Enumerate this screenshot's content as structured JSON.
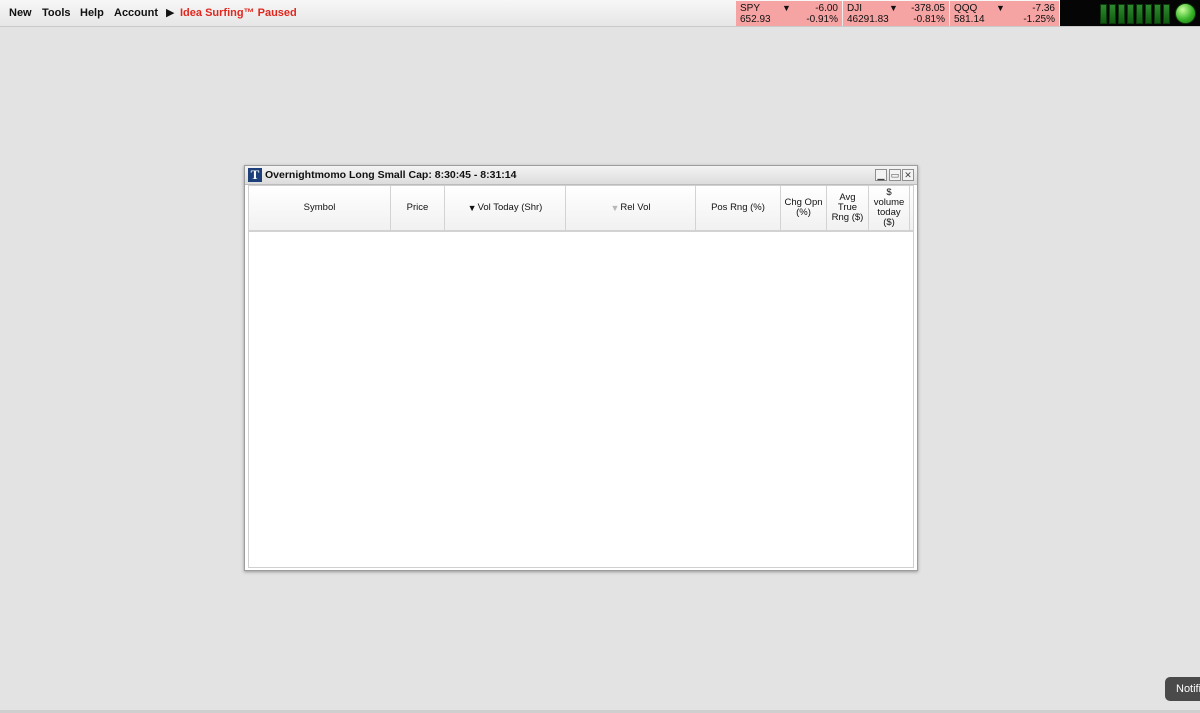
{
  "menubar": {
    "items": [
      {
        "label": "New"
      },
      {
        "label": "Tools"
      },
      {
        "label": "Help"
      },
      {
        "label": "Account"
      }
    ],
    "idea_status": "Idea Surfing™ Paused",
    "play_glyph": "▶"
  },
  "tickers": [
    {
      "symbol": "SPY",
      "change": "-6.00",
      "price": "652.93",
      "percent": "-0.91%",
      "direction": "down"
    },
    {
      "symbol": "DJI",
      "change": "-378.05",
      "price": "46291.83",
      "percent": "-0.81%",
      "direction": "down"
    },
    {
      "symbol": "QQQ",
      "change": "-7.36",
      "price": "581.14",
      "percent": "-1.25%",
      "direction": "down"
    }
  ],
  "window": {
    "icon_letter": "T",
    "title": "Overnightmomo Long Small Cap: 8:30:45 - 8:31:14",
    "columns": [
      {
        "label": "Symbol"
      },
      {
        "label": "Price"
      },
      {
        "label": "Vol Today (Shr)",
        "sort": "▼"
      },
      {
        "label": "Rel Vol",
        "sort": "▼"
      },
      {
        "label": "Pos Rng (%)"
      },
      {
        "label": "Chg Opn (%)"
      },
      {
        "label": "Avg True Rng ($)"
      },
      {
        "label": "$ volume today ($)"
      }
    ]
  },
  "notification": {
    "label": "Notifications"
  },
  "colors": {
    "ticker_down_bg": "#f5a3a3",
    "idea_text": "#e0261d",
    "status_led": "#39b52a"
  },
  "icons": {
    "ticker_arrow": "triangle-down-icon",
    "window_icon": "trade-ideas-logo-icon",
    "minimize": "minimize-icon",
    "maximize": "maximize-icon",
    "close": "close-icon"
  }
}
